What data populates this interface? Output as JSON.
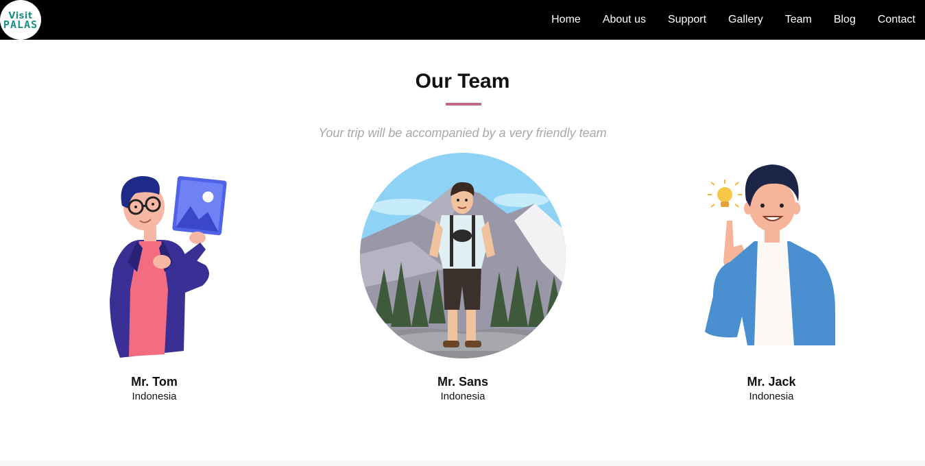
{
  "logo": {
    "line1": "Visit",
    "line2": "PALAS"
  },
  "nav": [
    {
      "label": "Home"
    },
    {
      "label": "About us"
    },
    {
      "label": "Support"
    },
    {
      "label": "Gallery"
    },
    {
      "label": "Team"
    },
    {
      "label": "Blog"
    },
    {
      "label": "Contact"
    }
  ],
  "section": {
    "title": "Our Team",
    "subtitle": "Your trip will be accompanied by a very friendly team",
    "accent_color": "#c06a86"
  },
  "members": [
    {
      "name": "Mr. Tom",
      "country": "Indonesia",
      "illustration": "man-with-photo-illustration"
    },
    {
      "name": "Mr. Sans",
      "country": "Indonesia",
      "illustration": "hiker-mountain-illustration"
    },
    {
      "name": "Mr. Jack",
      "country": "Indonesia",
      "illustration": "man-with-idea-illustration"
    }
  ]
}
